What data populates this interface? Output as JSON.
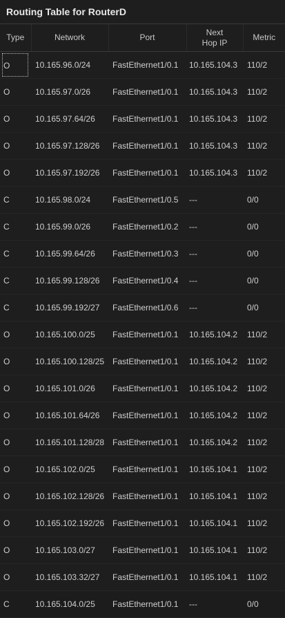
{
  "window": {
    "title": "Routing Table for RouterD"
  },
  "table": {
    "headers": {
      "type": "Type",
      "network": "Network",
      "port": "Port",
      "next_hop_line1": "Next",
      "next_hop_line2": "Hop IP",
      "metric": "Metric"
    },
    "rows": [
      {
        "type": "O",
        "network": "10.165.96.0/24",
        "port": "FastEthernet1/0.1",
        "next_hop": "10.165.104.3",
        "metric": "110/2"
      },
      {
        "type": "O",
        "network": "10.165.97.0/26",
        "port": "FastEthernet1/0.1",
        "next_hop": "10.165.104.3",
        "metric": "110/2"
      },
      {
        "type": "O",
        "network": "10.165.97.64/26",
        "port": "FastEthernet1/0.1",
        "next_hop": "10.165.104.3",
        "metric": "110/2"
      },
      {
        "type": "O",
        "network": "10.165.97.128/26",
        "port": "FastEthernet1/0.1",
        "next_hop": "10.165.104.3",
        "metric": "110/2"
      },
      {
        "type": "O",
        "network": "10.165.97.192/26",
        "port": "FastEthernet1/0.1",
        "next_hop": "10.165.104.3",
        "metric": "110/2"
      },
      {
        "type": "C",
        "network": "10.165.98.0/24",
        "port": "FastEthernet1/0.5",
        "next_hop": "---",
        "metric": "0/0"
      },
      {
        "type": "C",
        "network": "10.165.99.0/26",
        "port": "FastEthernet1/0.2",
        "next_hop": "---",
        "metric": "0/0"
      },
      {
        "type": "C",
        "network": "10.165.99.64/26",
        "port": "FastEthernet1/0.3",
        "next_hop": "---",
        "metric": "0/0"
      },
      {
        "type": "C",
        "network": "10.165.99.128/26",
        "port": "FastEthernet1/0.4",
        "next_hop": "---",
        "metric": "0/0"
      },
      {
        "type": "C",
        "network": "10.165.99.192/27",
        "port": "FastEthernet1/0.6",
        "next_hop": "---",
        "metric": "0/0"
      },
      {
        "type": "O",
        "network": "10.165.100.0/25",
        "port": "FastEthernet1/0.1",
        "next_hop": "10.165.104.2",
        "metric": "110/2"
      },
      {
        "type": "O",
        "network": "10.165.100.128/25",
        "port": "FastEthernet1/0.1",
        "next_hop": "10.165.104.2",
        "metric": "110/2"
      },
      {
        "type": "O",
        "network": "10.165.101.0/26",
        "port": "FastEthernet1/0.1",
        "next_hop": "10.165.104.2",
        "metric": "110/2"
      },
      {
        "type": "O",
        "network": "10.165.101.64/26",
        "port": "FastEthernet1/0.1",
        "next_hop": "10.165.104.2",
        "metric": "110/2"
      },
      {
        "type": "O",
        "network": "10.165.101.128/28",
        "port": "FastEthernet1/0.1",
        "next_hop": "10.165.104.2",
        "metric": "110/2"
      },
      {
        "type": "O",
        "network": "10.165.102.0/25",
        "port": "FastEthernet1/0.1",
        "next_hop": "10.165.104.1",
        "metric": "110/2"
      },
      {
        "type": "O",
        "network": "10.165.102.128/26",
        "port": "FastEthernet1/0.1",
        "next_hop": "10.165.104.1",
        "metric": "110/2"
      },
      {
        "type": "O",
        "network": "10.165.102.192/26",
        "port": "FastEthernet1/0.1",
        "next_hop": "10.165.104.1",
        "metric": "110/2"
      },
      {
        "type": "O",
        "network": "10.165.103.0/27",
        "port": "FastEthernet1/0.1",
        "next_hop": "10.165.104.1",
        "metric": "110/2"
      },
      {
        "type": "O",
        "network": "10.165.103.32/27",
        "port": "FastEthernet1/0.1",
        "next_hop": "10.165.104.1",
        "metric": "110/2"
      },
      {
        "type": "C",
        "network": "10.165.104.0/25",
        "port": "FastEthernet1/0.1",
        "next_hop": "---",
        "metric": "0/0"
      }
    ]
  },
  "colors": {
    "background": "#1e1e1e",
    "text": "#cfcfcf",
    "title_text": "#e8e8e8",
    "divider": "#3a3a3a"
  }
}
